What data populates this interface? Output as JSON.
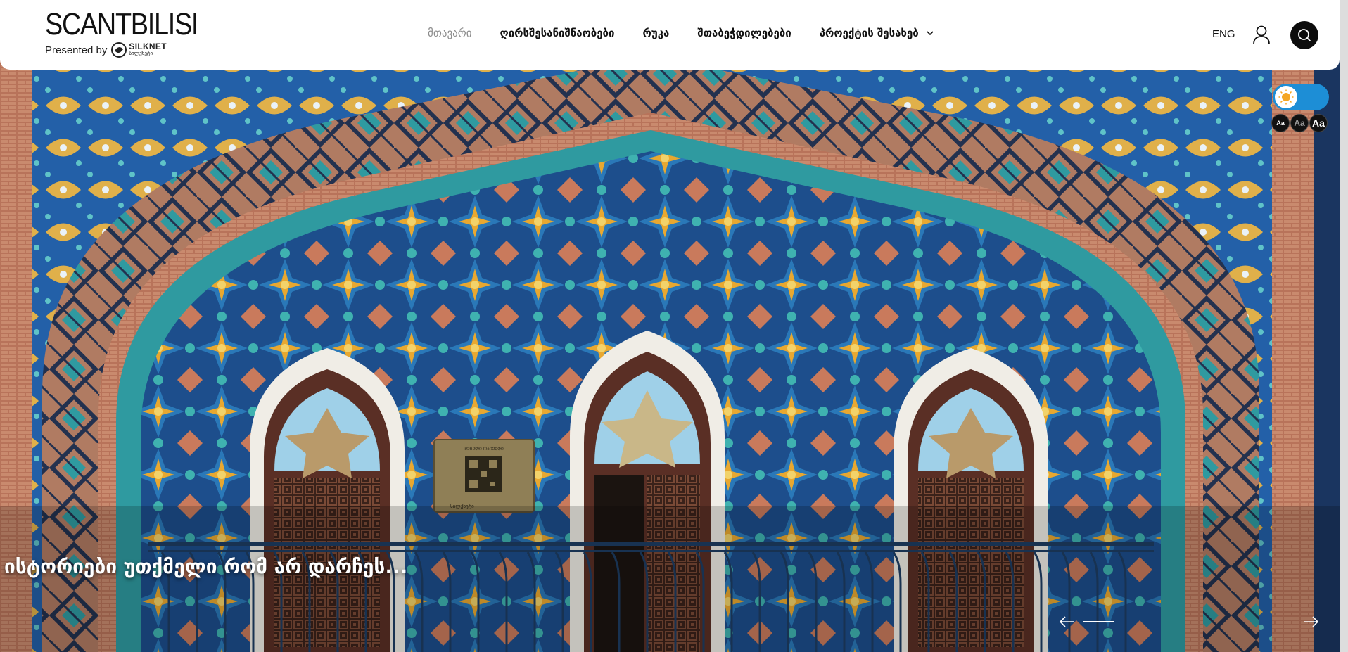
{
  "header": {
    "logo": {
      "title": "SCANTBILISI",
      "presented_by": "Presented by",
      "brand": "SILKNET",
      "brand_sub": "სილქნეტი"
    },
    "nav": [
      {
        "label": "მთავარი",
        "active": true
      },
      {
        "label": "ღირსშესანიშნაობები",
        "active": false
      },
      {
        "label": "რუკა",
        "active": false
      },
      {
        "label": "შთაბეჭდილებები",
        "active": false
      },
      {
        "label": "პროექტის შესახებ",
        "active": false,
        "has_dropdown": true
      }
    ],
    "language": "ENG",
    "icons": {
      "user": "user-icon",
      "search": "search-icon",
      "dropdown": "chevron-down-icon"
    }
  },
  "accessibility": {
    "theme_icon": "sun-icon",
    "font_sizes": [
      "Aa",
      "Aa",
      "Aa"
    ]
  },
  "hero": {
    "caption": "ისტორიები უთქმელი რომ არ დარჩეს...",
    "plaque_text": "ᲛᲔᲩᲔᲗᲘ ᲝᲑᲘᲔᲥᲢᲘ",
    "plaque_brand": "სილქნეტი",
    "slider": {
      "progress": 0.15,
      "prev_icon": "arrow-left-icon",
      "next_icon": "arrow-right-icon"
    }
  },
  "colors": {
    "accent_toggle": "#1d8ed6",
    "header_bg": "#ffffff",
    "nav_active": "#8c8c8c"
  }
}
